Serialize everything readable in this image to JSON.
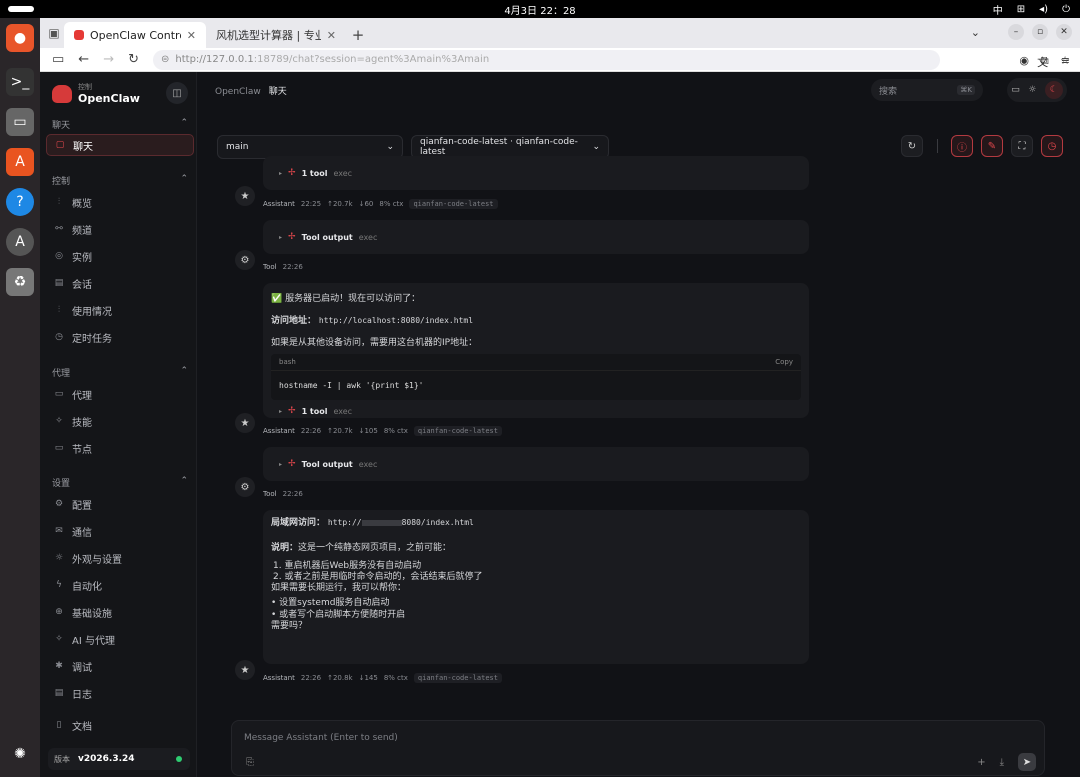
{
  "os": {
    "clock": "4月3日  22：28",
    "ime": "中"
  },
  "browser": {
    "tabs": [
      {
        "label": "OpenClaw Control"
      },
      {
        "label": "风机选型计算器 | 专业工业通"
      }
    ],
    "url_host": "http://127.0.0.1",
    "url_rest": ":18789/chat?session=agent%3Amain%3Amain"
  },
  "sidebar": {
    "logo_sub": "控制",
    "logo_main": "OpenClaw",
    "sections": [
      {
        "title": "聊天",
        "items": [
          "聊天"
        ]
      },
      {
        "title": "控制",
        "items": [
          "概览",
          "频道",
          "实例",
          "会话",
          "使用情况",
          "定时任务"
        ]
      },
      {
        "title": "代理",
        "items": [
          "代理",
          "技能",
          "节点"
        ]
      },
      {
        "title": "设置",
        "items": [
          "配置",
          "通信",
          "外观与设置",
          "自动化",
          "基础设施",
          "AI 与代理",
          "调试",
          "日志"
        ]
      }
    ],
    "docs": "文档",
    "version_label": "版本",
    "version": "v2026.3.24"
  },
  "header": {
    "crumb_root": "OpenClaw",
    "crumb_current": "聊天",
    "search_placeholder": "搜索",
    "search_key": "⌘K"
  },
  "toolbar": {
    "session_select": "main",
    "model_select": "qianfan-code-latest · qianfan-code-latest"
  },
  "messages": [
    {
      "role": "Assistant",
      "time": "22:25",
      "up": "↑20.7k",
      "down": "↓60",
      "ctx": "8% ctx",
      "model": "qianfan-code-latest",
      "tool_label": "1 tool",
      "tool_name": "exec"
    },
    {
      "role": "Tool",
      "time": "22:26",
      "tool_label": "Tool output",
      "tool_name": "exec"
    },
    {
      "role": "Assistant",
      "time": "22:26",
      "up": "↑20.7k",
      "down": "↓105",
      "ctx": "8% ctx",
      "model": "qianfan-code-latest",
      "line1": "✅ 服务器已启动！现在可以访问了：",
      "addr_label": "访问地址：",
      "addr_value": "http://localhost:8080/index.html",
      "line3": "如果是从其他设备访问，需要用这台机器的IP地址：",
      "code_lang": "bash",
      "code_copy": "Copy",
      "code": "hostname -I | awk '{print $1}'",
      "tool_label": "1 tool",
      "tool_name": "exec"
    },
    {
      "role": "Tool",
      "time": "22:26",
      "tool_label": "Tool output",
      "tool_name": "exec"
    },
    {
      "role": "Assistant",
      "time": "22:26",
      "up": "↑20.8k",
      "down": "↓145",
      "ctx": "8% ctx",
      "model": "qianfan-code-latest",
      "lan_label": "局域网访问：",
      "lan_value_a": "http://",
      "lan_value_b": "8080/index.html",
      "note_label": "说明：",
      "note_text": "这是一个纯静态网页项目，之前可能：",
      "points": [
        "1. 重启机器后Web服务没有自动启动",
        "2. 或者之前是用临时命令启动的，会话结束后就停了"
      ],
      "more": "如果需要长期运行，我可以帮你：",
      "bullets": [
        "设置systemd服务自动启动",
        "或者写个启动脚本方便随时开启"
      ],
      "ask": "需要吗？"
    }
  ],
  "composer": {
    "placeholder": "Message Assistant (Enter to send)"
  }
}
